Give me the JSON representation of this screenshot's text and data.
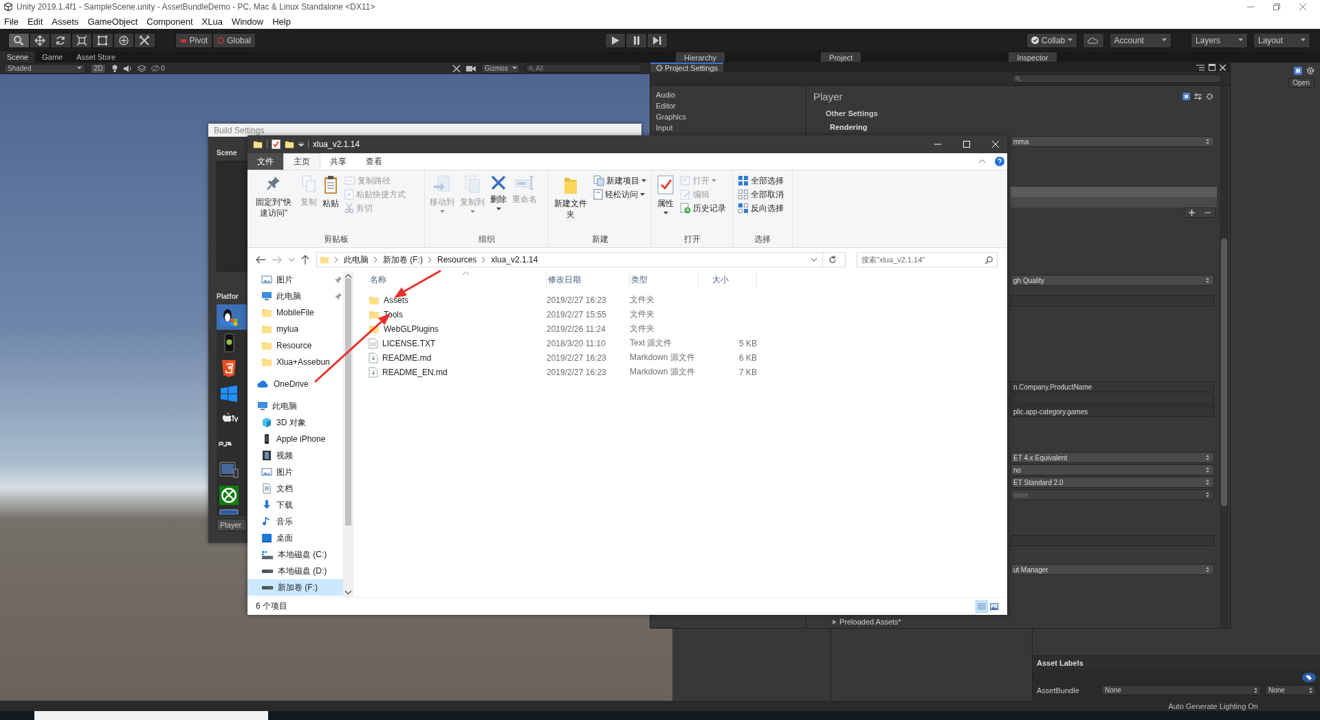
{
  "unity": {
    "title": "Unity 2019.1.4f1 - SampleScene.unity - AssetBundleDemo - PC, Mac & Linux Standalone <DX11>",
    "menu": [
      "File",
      "Edit",
      "Assets",
      "GameObject",
      "Component",
      "XLua",
      "Window",
      "Help"
    ],
    "tools": [
      {
        "kind": "view",
        "selected": true
      },
      {
        "kind": "move",
        "selected": false
      },
      {
        "kind": "rotate",
        "selected": false
      },
      {
        "kind": "scale",
        "selected": false
      },
      {
        "kind": "rect",
        "selected": false
      },
      {
        "kind": "transform",
        "selected": false
      },
      {
        "kind": "custom",
        "selected": false
      }
    ],
    "pivot": "Pivot",
    "global": "Global",
    "collab": "Collab",
    "account": "Account",
    "layers": "Layers",
    "layout": "Layout",
    "scene_tabs": [
      {
        "label": "Scene",
        "selected": true
      },
      {
        "label": "Game",
        "selected": false
      },
      {
        "label": "Asset Store",
        "selected": false
      }
    ],
    "panel_tabs": [
      "Hierarchy",
      "Project",
      "Inspector"
    ],
    "scene_toolbar": {
      "shading": "Shaded",
      "mode": "2D",
      "hidden_count": "0",
      "gizmos": "Gizmos",
      "search_placeholder": "All"
    },
    "status": "Auto Generate Lighting On"
  },
  "build_settings": {
    "title": "Build Settings",
    "scenes_heading": "Scene",
    "platforms_heading": "Platfor",
    "platforms": [
      {
        "kind": "standalone",
        "selected": true
      },
      {
        "kind": "android",
        "selected": false
      },
      {
        "kind": "webgl",
        "selected": false
      },
      {
        "kind": "windows",
        "selected": false
      },
      {
        "kind": "tvos",
        "selected": false
      },
      {
        "kind": "ps4",
        "selected": false
      },
      {
        "kind": "ios",
        "selected": false
      },
      {
        "kind": "xbox",
        "selected": false
      },
      {
        "kind": "partial",
        "selected": false
      }
    ],
    "player_button": "Player"
  },
  "project_settings": {
    "title": "Project Settings",
    "categories": [
      "Audio",
      "Editor",
      "Graphics",
      "Input"
    ],
    "heading": "Player",
    "sections": [
      "Other Settings",
      "Rendering"
    ],
    "rows": [
      {
        "kind": "dropdown",
        "value": "mma"
      },
      {
        "kind": "list"
      },
      {
        "kind": "dropdown",
        "value": "gh Quality"
      },
      {
        "kind": "field"
      },
      {
        "kind": "field",
        "value": "n.Company.ProductName"
      },
      {
        "kind": "field"
      },
      {
        "kind": "field",
        "value": "plic.app-category.games"
      },
      {
        "kind": "dropdown",
        "value": "ET 4.x Equivalent"
      },
      {
        "kind": "dropdown",
        "value": "no"
      },
      {
        "kind": "dropdown",
        "value": "ET Standard 2.0"
      },
      {
        "kind": "inactive_dropdown",
        "value": "ease"
      },
      {
        "kind": "field"
      },
      {
        "kind": "dropdown",
        "value": "ut Manager"
      }
    ],
    "footer_item": "Preloaded Assets*"
  },
  "inspector": {
    "open_button": "Open",
    "asset_labels": {
      "title": "Asset Labels",
      "label": "AssetBundle",
      "bundle_name": "None",
      "bundle_variant": "None"
    }
  },
  "explorer": {
    "title": "xlua_v2.1.14",
    "tabs": [
      {
        "label": "文件",
        "kind": "file",
        "selected": false
      },
      {
        "label": "主页",
        "kind": "tab",
        "selected": true
      },
      {
        "label": "共享",
        "kind": "tab",
        "selected": false
      },
      {
        "label": "查看",
        "kind": "tab",
        "selected": false
      }
    ],
    "ribbon": [
      {
        "label": "剪贴板",
        "items": [
          {
            "kind": "large",
            "text": "固定到“快速访问”",
            "disabled": false,
            "menu": false
          },
          {
            "kind": "large",
            "text": "复制",
            "disabled": true,
            "menu": false
          },
          {
            "kind": "large",
            "text": "粘贴",
            "disabled": false,
            "menu": false
          },
          {
            "kind": "small",
            "text": "复制路径",
            "disabled": true,
            "menu": false
          },
          {
            "kind": "small",
            "text": "粘贴快捷方式",
            "disabled": true,
            "menu": false
          },
          {
            "kind": "small",
            "text": "剪切",
            "disabled": true,
            "menu": false
          }
        ]
      },
      {
        "label": "组织",
        "items": [
          {
            "kind": "large",
            "text": "移动到",
            "disabled": true,
            "menu": true
          },
          {
            "kind": "large",
            "text": "复制到",
            "disabled": true,
            "menu": true
          },
          {
            "kind": "large",
            "text": "删除",
            "disabled": false,
            "menu": true
          },
          {
            "kind": "large",
            "text": "重命名",
            "disabled": true,
            "menu": false
          }
        ]
      },
      {
        "label": "新建",
        "items": [
          {
            "kind": "large",
            "text": "新建文件夹",
            "disabled": false,
            "menu": false
          },
          {
            "kind": "small",
            "text": "新建项目",
            "disabled": false,
            "menu": true
          },
          {
            "kind": "small",
            "text": "轻松访问",
            "disabled": false,
            "menu": true
          }
        ]
      },
      {
        "label": "打开",
        "items": [
          {
            "kind": "large",
            "text": "属性",
            "disabled": false,
            "menu": true
          },
          {
            "kind": "small",
            "text": "打开",
            "disabled": true,
            "menu": true
          },
          {
            "kind": "small",
            "text": "编辑",
            "disabled": true,
            "menu": false
          },
          {
            "kind": "small",
            "text": "历史记录",
            "disabled": false,
            "menu": false
          }
        ]
      },
      {
        "label": "选择",
        "items": [
          {
            "kind": "small",
            "text": "全部选择",
            "disabled": false,
            "menu": false
          },
          {
            "kind": "small",
            "text": "全部取消",
            "disabled": false,
            "menu": false
          },
          {
            "kind": "small",
            "text": "反向选择",
            "disabled": false,
            "menu": false
          }
        ]
      }
    ],
    "address": [
      "此电脑",
      "新加卷 (F:)",
      "Resources",
      "xlua_v2.1.14"
    ],
    "search_placeholder": "搜索\"xlua_v2.1.14\"",
    "quick_access": [
      {
        "label": "图片",
        "kind": "pictures",
        "pinned": true,
        "selected": false
      },
      {
        "label": "此电脑",
        "kind": "pc",
        "pinned": true,
        "selected": false
      },
      {
        "label": "MobileFile",
        "kind": "folder",
        "pinned": false,
        "selected": false
      },
      {
        "label": "mylua",
        "kind": "folder",
        "pinned": false,
        "selected": false
      },
      {
        "label": "Resource",
        "kind": "folder",
        "pinned": false,
        "selected": false
      },
      {
        "label": "Xlua+Assebun",
        "kind": "folder",
        "pinned": false,
        "selected": false
      }
    ],
    "locations": [
      {
        "label": "OneDrive",
        "kind": "cloud",
        "selected": false
      },
      {
        "label": "此电脑",
        "kind": "pc",
        "selected": false,
        "children": [
          {
            "label": "3D 对象",
            "kind": "cube",
            "selected": false
          },
          {
            "label": "Apple iPhone",
            "kind": "phone",
            "selected": false
          },
          {
            "label": "视频",
            "kind": "videos",
            "selected": false
          },
          {
            "label": "图片",
            "kind": "pictures",
            "selected": false
          },
          {
            "label": "文档",
            "kind": "documents",
            "selected": false
          },
          {
            "label": "下载",
            "kind": "downloads",
            "selected": false
          },
          {
            "label": "音乐",
            "kind": "music",
            "selected": false
          },
          {
            "label": "桌面",
            "kind": "desktop",
            "selected": false
          },
          {
            "label": "本地磁盘 (C:)",
            "kind": "system_drive",
            "selected": false
          },
          {
            "label": "本地磁盘 (D:)",
            "kind": "drive",
            "selected": false
          },
          {
            "label": "新加卷 (F:)",
            "kind": "drive",
            "selected": true
          }
        ]
      }
    ],
    "columns": [
      "名称",
      "修改日期",
      "类型",
      "大小"
    ],
    "files": [
      {
        "kind": "folder",
        "name": "Assets",
        "modified": "2019/2/27 16:23",
        "type": "文件夹"
      },
      {
        "kind": "folder",
        "name": "Tools",
        "modified": "2019/2/27 15:55",
        "type": "文件夹"
      },
      {
        "kind": "folder",
        "name": "WebGLPlugins",
        "modified": "2019/2/26 11:24",
        "type": "文件夹"
      },
      {
        "kind": "text",
        "name": "LICENSE.TXT",
        "modified": "2018/3/20 11:10",
        "type": "Text 源文件",
        "size": "5 KB"
      },
      {
        "kind": "markdown",
        "name": "README.md",
        "modified": "2019/2/27 16:23",
        "type": "Markdown 源文件",
        "size": "6 KB"
      },
      {
        "kind": "markdown",
        "name": "README_EN.md",
        "modified": "2019/2/27 16:23",
        "type": "Markdown 源文件",
        "size": "7 KB"
      }
    ],
    "status": "6 个项目",
    "views": [
      {
        "kind": "details",
        "selected": true
      },
      {
        "kind": "tiles",
        "selected": false
      }
    ]
  }
}
